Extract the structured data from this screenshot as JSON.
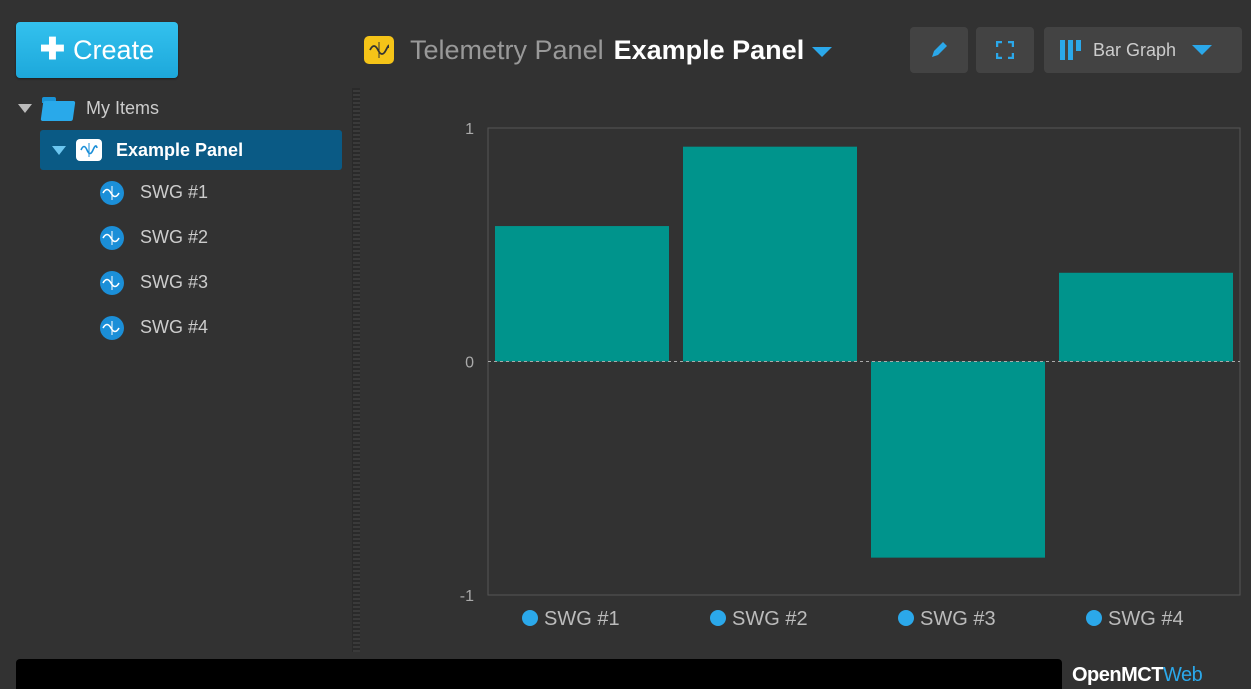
{
  "toolbar": {
    "create_label": "Create"
  },
  "tree": {
    "root_label": "My Items",
    "selected_label": "Example Panel",
    "children": [
      "SWG #1",
      "SWG #2",
      "SWG #3",
      "SWG #4"
    ]
  },
  "header": {
    "type_label": "Telemetry Panel",
    "object_name": "Example Panel",
    "view_label": "Bar Graph"
  },
  "chart_data": {
    "type": "bar",
    "categories": [
      "SWG #1",
      "SWG #2",
      "SWG #3",
      "SWG #4"
    ],
    "values": [
      0.58,
      0.92,
      -0.84,
      0.38
    ],
    "ylim": [
      -1,
      1
    ],
    "yticks": [
      "1",
      "0",
      "-1"
    ],
    "bar_color": "#00948c",
    "grid": false
  },
  "footer": {
    "brand_main": "OpenMCT",
    "brand_accent": "Web"
  },
  "colors": {
    "accent": "#2ba8ea",
    "create": "#1da8db",
    "selection": "#0a5a85",
    "panel_icon": "#f5c418"
  }
}
